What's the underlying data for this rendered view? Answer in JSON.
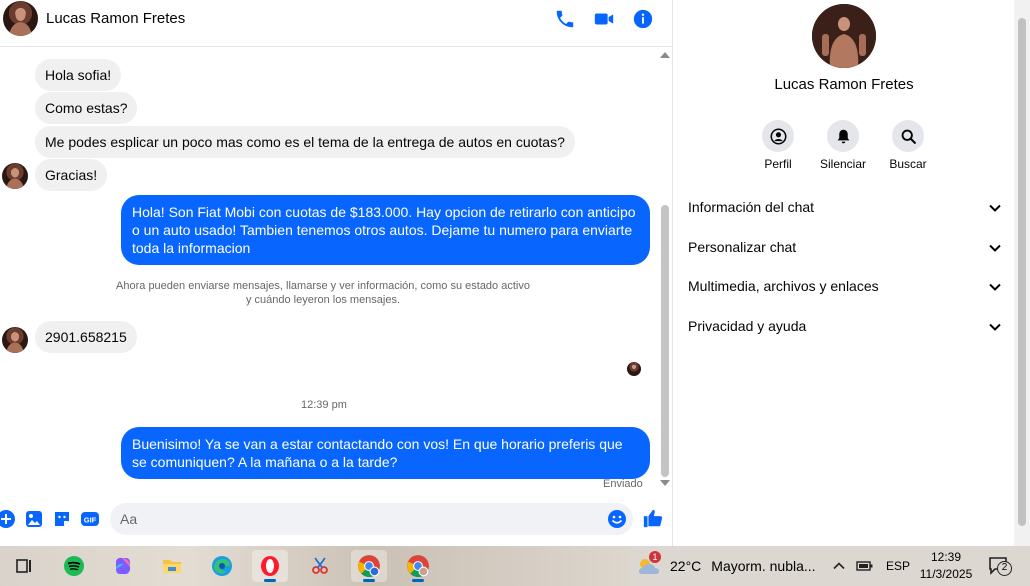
{
  "chat": {
    "contact_name": "Lucas Ramon Fretes",
    "messages": [
      {
        "dir": "in",
        "text": "Hola sofia!"
      },
      {
        "dir": "in",
        "text": "Como estas?"
      },
      {
        "dir": "in",
        "text": "Me podes esplicar un poco mas como es el tema de la entrega de autos en cuotas?"
      },
      {
        "dir": "in",
        "text": "Gracias!"
      },
      {
        "dir": "out",
        "text": "Hola! Son Fiat Mobi con cuotas de $183.000. Hay opcion de retirarlo con anticipo o un auto usado! Tambien tenemos otros autos. Dejame tu numero para enviarte toda la informacion"
      },
      {
        "dir": "in",
        "text": "2901.658215"
      },
      {
        "dir": "out",
        "text": "Buenisimo! Ya se van a estar contactando con vos! En que horario preferis que se comuniquen? A la mañana o a la tarde?"
      }
    ],
    "notice_line1": "Ahora pueden enviarse mensajes, llamarse y ver información, como su estado activo",
    "notice_line2": "y cuándo leyeron los mensajes.",
    "timestamp": "12:39 pm",
    "status": "Enviado",
    "composer_placeholder": "Aa"
  },
  "info": {
    "name": "Lucas Ramon Fretes",
    "actions": [
      {
        "label": "Perfil",
        "icon": "profile-icon"
      },
      {
        "label": "Silenciar",
        "icon": "bell-icon"
      },
      {
        "label": "Buscar",
        "icon": "search-icon"
      }
    ],
    "sections": [
      "Información del chat",
      "Personalizar chat",
      "Multimedia, archivos y enlaces",
      "Privacidad y ayuda"
    ]
  },
  "taskbar": {
    "weather_alert": "1",
    "temperature": "22°C",
    "weather_text": "Mayorm. nubla...",
    "language": "ESP",
    "time": "12:39",
    "date": "11/3/2025",
    "notifications": "2"
  },
  "colors": {
    "accent": "#0866ff",
    "incoming_bubble": "#f0f0f0",
    "muted_text": "#65676b"
  }
}
